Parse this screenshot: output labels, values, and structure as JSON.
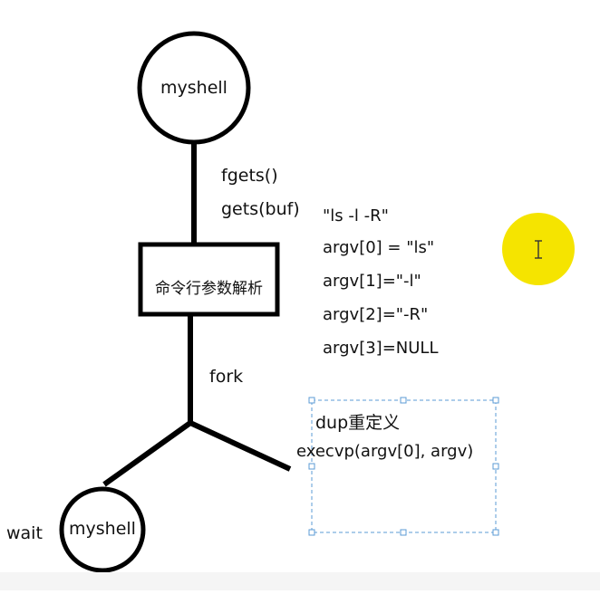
{
  "nodes": {
    "top_process": "myshell",
    "parser": "命令行参数解析",
    "child_process": "myshell"
  },
  "edges": {
    "read_input": [
      "fgets()",
      "gets(buf)"
    ],
    "fork": "fork",
    "wait": "wait"
  },
  "parse_example": {
    "command": "\"ls  -l  -R\"",
    "argv": [
      "argv[0] = \"ls\"",
      "argv[1]=\"-l\"",
      "argv[2]=\"-R\"",
      "argv[3]=NULL"
    ]
  },
  "child_box": {
    "line1": "dup重定义",
    "line2": "execvp(argv[0], argv)"
  },
  "cursor": {
    "icon": "text-cursor-icon",
    "highlight_color": "#f5e400"
  }
}
